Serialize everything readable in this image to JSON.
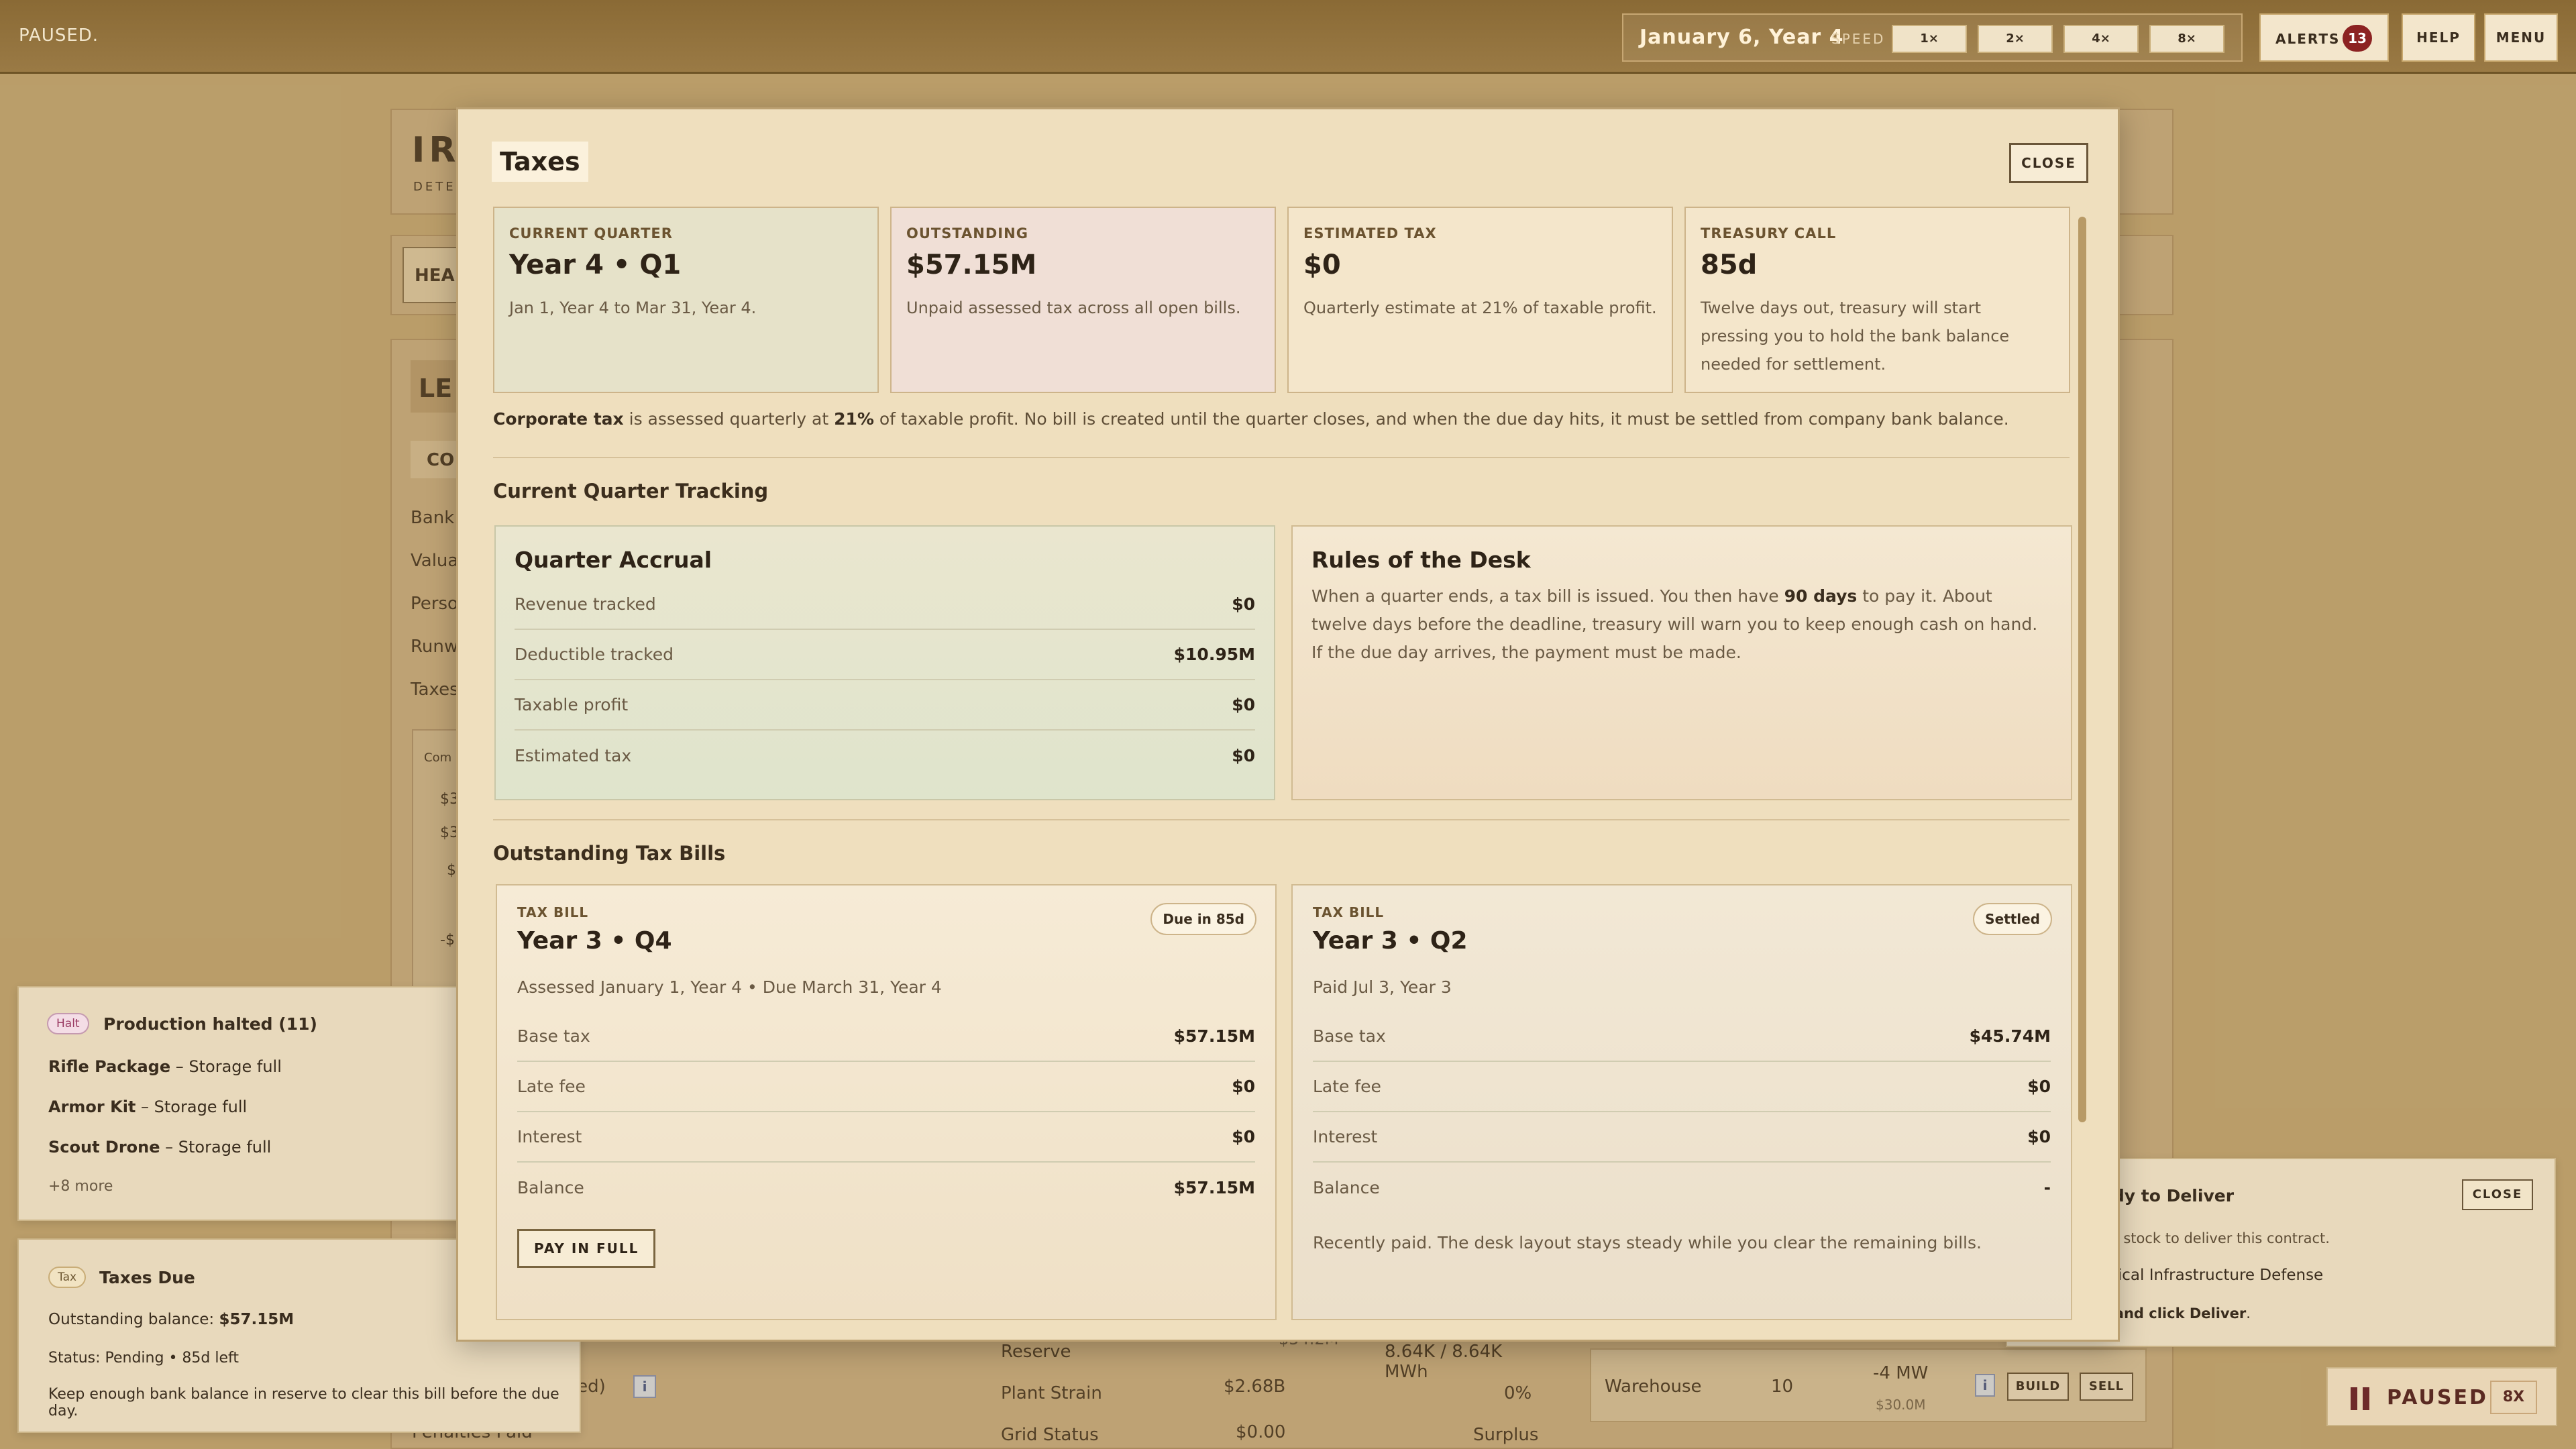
{
  "topbar": {
    "status": "PAUSED.",
    "date": "January 6, Year 4",
    "speed_label": "SPEED",
    "speeds": [
      "1×",
      "2×",
      "4×",
      "8×"
    ],
    "alerts_label": "ALERTS",
    "alerts_count": "13",
    "help": "HELP",
    "menu": "MENU"
  },
  "background": {
    "header_initials": "IR",
    "header_sub": "DETE",
    "tab_fragment": "HEA",
    "panel_fragment": "LE",
    "col_fragment": "CO",
    "side_rows": [
      "Bank I",
      "Valuat",
      "Perso",
      "Runw",
      "Taxes"
    ],
    "chart_fragment": "Com",
    "mini_values": [
      "$3",
      "$3",
      "$",
      "-$"
    ],
    "bottom_rows": [
      {
        "label": "ered)",
        "value": "$2.68B"
      },
      {
        "label": "Penalties Paid",
        "value": "$0.00"
      }
    ],
    "bottom_value_partial": "$54.2M",
    "power_rows": [
      {
        "label": "Reserve",
        "value": "8.64K / 8.64K MWh"
      },
      {
        "label": "Plant Strain",
        "value": "0%"
      },
      {
        "label": "Grid Status",
        "value": "Surplus"
      }
    ],
    "warehouse": {
      "name": "Warehouse",
      "count": "10",
      "power": "-4 MW",
      "cost": "$30.0M",
      "build": "BUILD",
      "sell": "SELL"
    }
  },
  "notifications": {
    "halt": {
      "chip": "Halt",
      "title": "Production halted (11)",
      "items": [
        {
          "name": "Rifle Package",
          "reason": " – Storage full"
        },
        {
          "name": "Armor Kit",
          "reason": " – Storage full"
        },
        {
          "name": "Scout Drone",
          "reason": " – Storage full"
        }
      ],
      "more": "+8 more"
    },
    "tax": {
      "chip": "Tax",
      "title": "Taxes Due",
      "balance_label": "Outstanding balance: ",
      "balance_value": "$57.15M",
      "status": "Status: Pending • 85d left",
      "hint": "Keep enough bank balance in reserve to clear this bill before the due day."
    },
    "deliver": {
      "title": "ady to Deliver",
      "close": "CLOSE",
      "line1": "gh stock to deliver this contract.",
      "line2": "ritical Infrastructure Defense",
      "line3_pre": "s and click ",
      "line3_bold": "Deliver",
      "line3_post": "."
    }
  },
  "statusbar": {
    "label": "PAUSED",
    "speed": "8X"
  },
  "modal": {
    "title": "Taxes",
    "close": "CLOSE",
    "stats": [
      {
        "key": "CURRENT QUARTER",
        "value": "Year 4 • Q1",
        "desc": "Jan 1, Year 4 to Mar 31, Year 4.",
        "bg": "#e6e2c9"
      },
      {
        "key": "OUTSTANDING",
        "value": "$57.15M",
        "desc": "Unpaid assessed tax across all open bills.",
        "bg": "#f0dfd6"
      },
      {
        "key": "ESTIMATED TAX",
        "value": "$0",
        "desc": "Quarterly estimate at 21% of taxable profit.",
        "bg": "#f4e6cb"
      },
      {
        "key": "TREASURY CALL",
        "value": "85d",
        "desc": "Twelve days out, treasury will start pressing you to hold the bank balance needed for settlement.",
        "bg": "#f4e6cb"
      }
    ],
    "note": {
      "b1": "Corporate tax",
      "t1": " is assessed quarterly at ",
      "b2": "21%",
      "t2": " of taxable profit. No bill is created until the quarter closes, and when the due day hits, it must be settled from company bank balance."
    },
    "tracking_title": "Current Quarter Tracking",
    "accrual": {
      "title": "Quarter Accrual",
      "rows": [
        {
          "label": "Revenue tracked",
          "value": "$0"
        },
        {
          "label": "Deductible tracked",
          "value": "$10.95M"
        },
        {
          "label": "Taxable profit",
          "value": "$0"
        },
        {
          "label": "Estimated tax",
          "value": "$0"
        }
      ]
    },
    "rules": {
      "title": "Rules of the Desk",
      "t1": "When a quarter ends, a tax bill is issued. You then have ",
      "b1": "90 days",
      "t2": " to pay it. About twelve days before the deadline, treasury will warn you to keep enough cash on hand. If the due day arrives, the payment must be made."
    },
    "bills_title": "Outstanding Tax Bills",
    "bills": [
      {
        "kind": "TAX BILL",
        "title": "Year 3 • Q4",
        "badge": "Due in 85d",
        "desc": "Assessed January 1, Year 4 • Due March 31, Year 4",
        "rows": [
          {
            "label": "Base tax",
            "value": "$57.15M"
          },
          {
            "label": "Late fee",
            "value": "$0"
          },
          {
            "label": "Interest",
            "value": "$0"
          },
          {
            "label": "Balance",
            "value": "$57.15M"
          }
        ],
        "action": "PAY IN FULL"
      },
      {
        "kind": "TAX BILL",
        "title": "Year 3 • Q2",
        "badge": "Settled",
        "desc": "Paid Jul 3, Year 3",
        "rows": [
          {
            "label": "Base tax",
            "value": "$45.74M"
          },
          {
            "label": "Late fee",
            "value": "$0"
          },
          {
            "label": "Interest",
            "value": "$0"
          },
          {
            "label": "Balance",
            "value": "-"
          }
        ],
        "note": "Recently paid. The desk layout stays steady while you clear the remaining bills."
      }
    ]
  }
}
